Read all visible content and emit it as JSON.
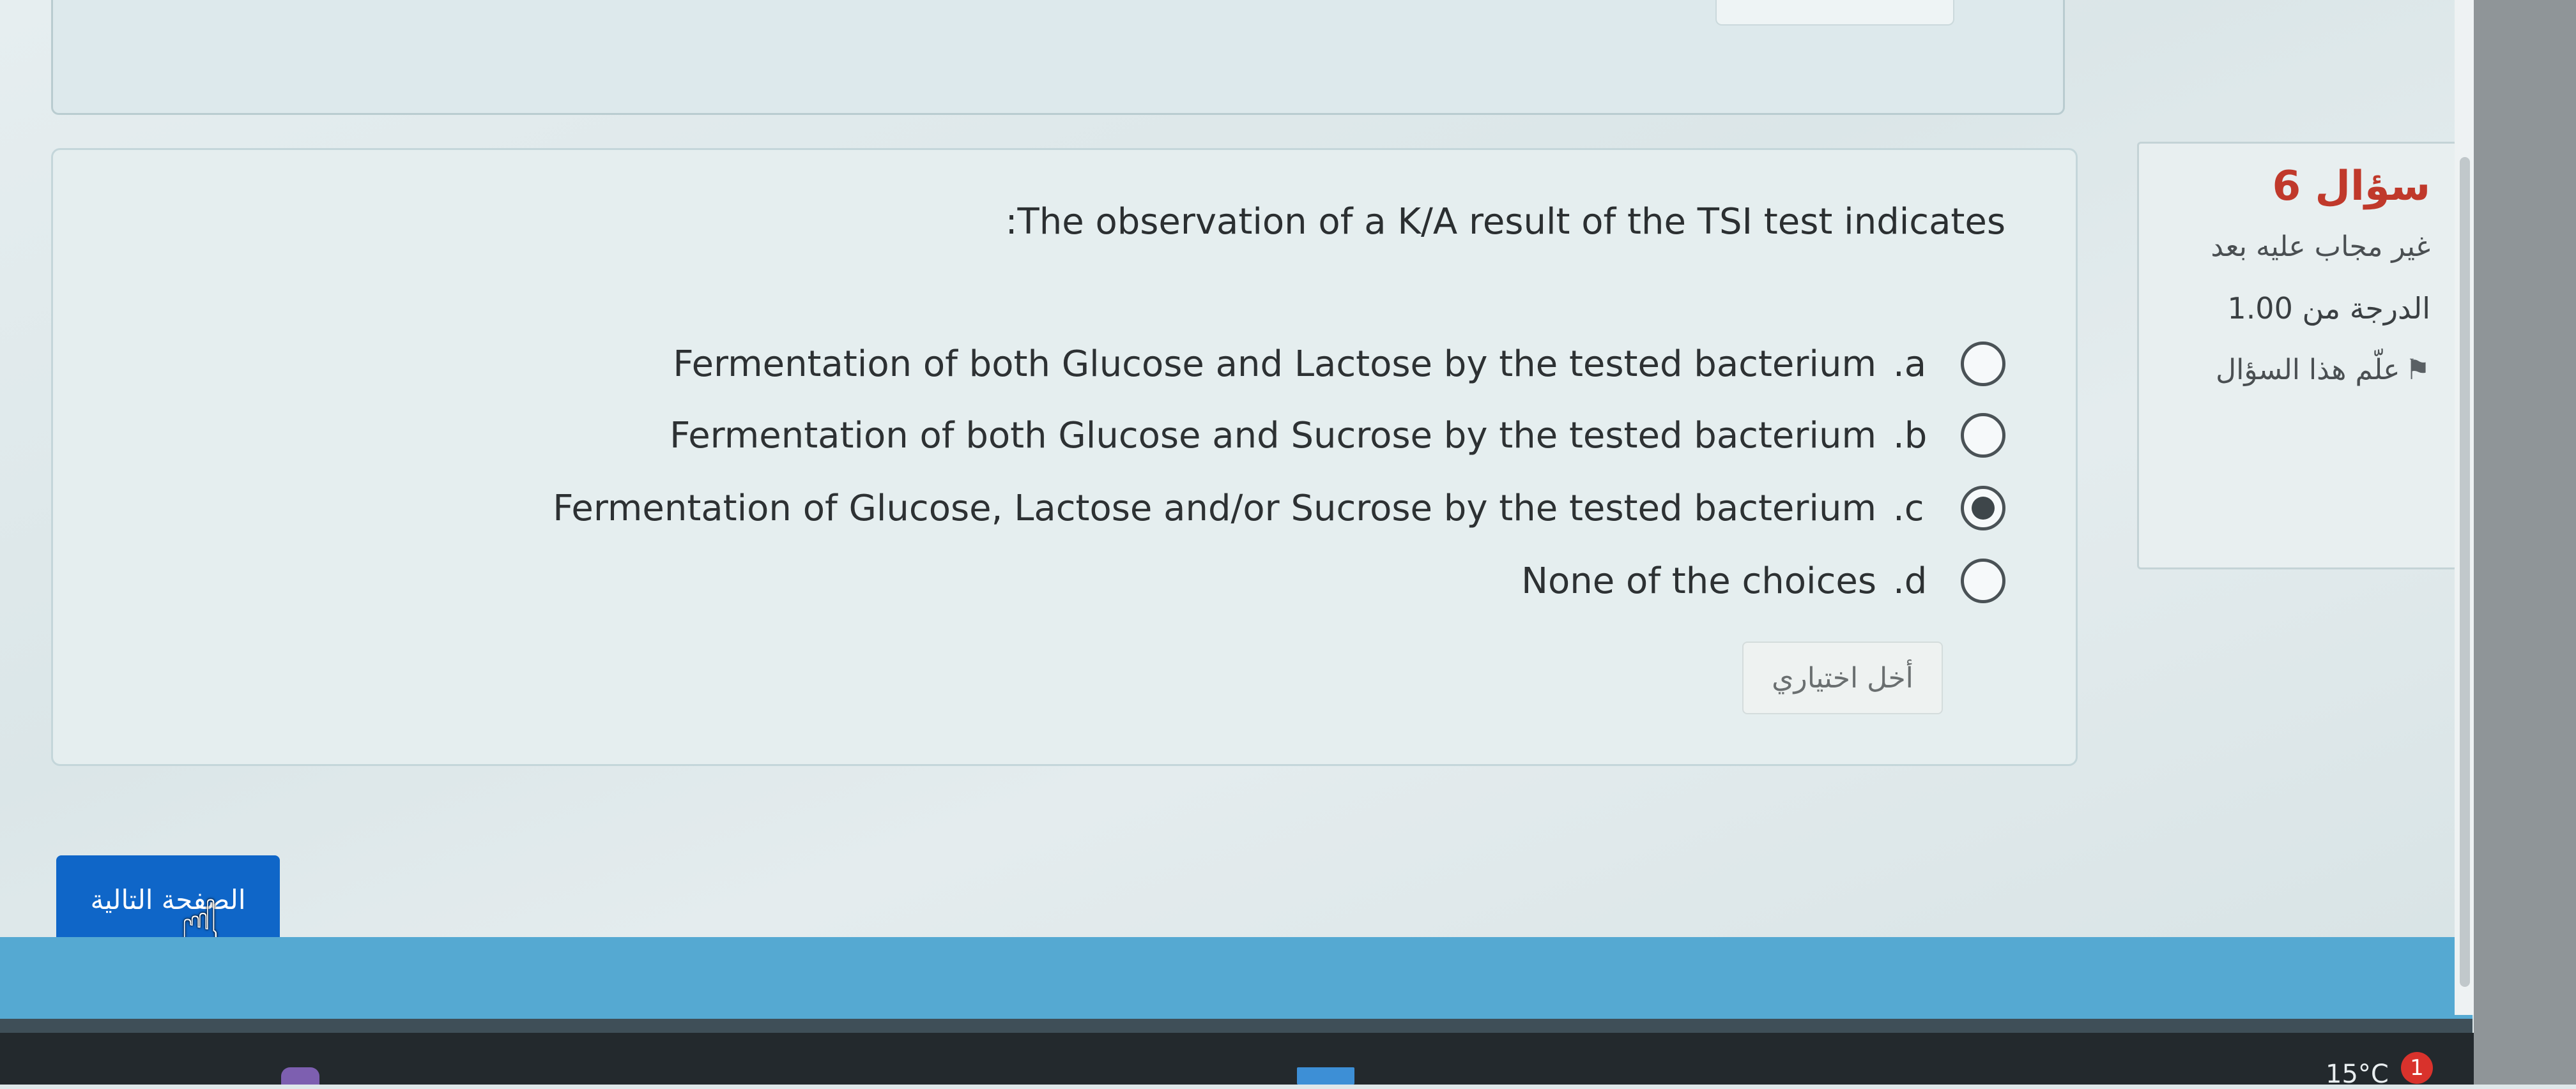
{
  "question": {
    "prompt": ":The observation of a K/A result of the TSI test indicates",
    "options": [
      {
        "letter": ".a",
        "text": "Fermentation of both Glucose and Lactose by the tested bacterium",
        "selected": false
      },
      {
        "letter": ".b",
        "text": "Fermentation of both Glucose and Sucrose by the tested bacterium",
        "selected": false
      },
      {
        "letter": ".c",
        "text": "Fermentation of Glucose, Lactose and/or Sucrose by the tested bacterium",
        "selected": true
      },
      {
        "letter": ".d",
        "text": "None of the choices",
        "selected": false
      }
    ],
    "clear_label": "أخل اختياري"
  },
  "info": {
    "title": "سؤال 6",
    "status": "غير مجاب عليه بعد",
    "grade": "الدرجة من 1.00",
    "flag_label": "علّم هذا السؤال"
  },
  "nav": {
    "next_label": "الصفحة التالية"
  },
  "taskbar": {
    "temperature": "15°C",
    "notification_count": "1"
  },
  "colors": {
    "accent": "#0f66c8",
    "title_red": "#c0392b",
    "footer_band": "#55a9d2"
  }
}
